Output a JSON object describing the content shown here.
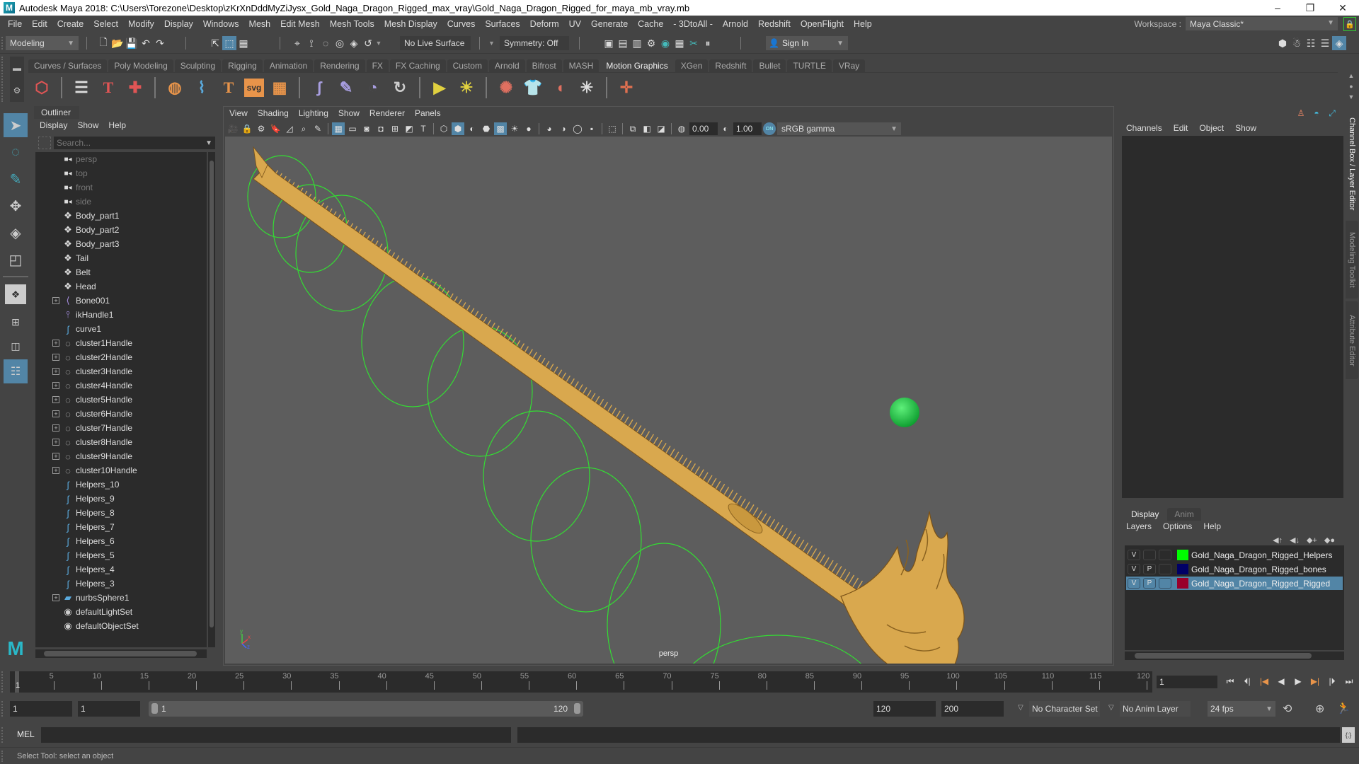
{
  "window": {
    "title": "Autodesk Maya 2018: C:\\Users\\Torezone\\Desktop\\zKrXnDddMyZiJysx_Gold_Naga_Dragon_Rigged_max_vray\\Gold_Naga_Dragon_Rigged_for_maya_mb_vray.mb",
    "minimize": "–",
    "restore": "❐",
    "close": "✕"
  },
  "menubar": {
    "items": [
      "File",
      "Edit",
      "Create",
      "Select",
      "Modify",
      "Display",
      "Windows",
      "Mesh",
      "Edit Mesh",
      "Mesh Tools",
      "Mesh Display",
      "Curves",
      "Surfaces",
      "Deform",
      "UV",
      "Generate",
      "Cache",
      "- 3DtoAll -",
      "Arnold",
      "Redshift",
      "OpenFlight",
      "Help"
    ],
    "workspace_label": "Workspace :",
    "workspace_value": "Maya Classic*"
  },
  "statusline": {
    "mode": "Modeling",
    "live_surface": "No Live Surface",
    "symmetry": "Symmetry: Off",
    "sign_in": "Sign In"
  },
  "shelf": {
    "tabs": [
      "Curves / Surfaces",
      "Poly Modeling",
      "Sculpting",
      "Rigging",
      "Animation",
      "Rendering",
      "FX",
      "FX Caching",
      "Custom",
      "Arnold",
      "Bifrost",
      "MASH",
      "Motion Graphics",
      "XGen",
      "Redshift",
      "Bullet",
      "TURTLE",
      "VRay"
    ],
    "active_tab": "Motion Graphics"
  },
  "outliner": {
    "title": "Outliner",
    "menu": [
      "Display",
      "Show",
      "Help"
    ],
    "search_placeholder": "Search...",
    "items": [
      {
        "name": "persp",
        "icon": "camera-icon",
        "expandable": false,
        "dim": true
      },
      {
        "name": "top",
        "icon": "camera-icon",
        "expandable": false,
        "dim": true
      },
      {
        "name": "front",
        "icon": "camera-icon",
        "expandable": false,
        "dim": true
      },
      {
        "name": "side",
        "icon": "camera-icon",
        "expandable": false,
        "dim": true
      },
      {
        "name": "Body_part1",
        "icon": "mesh-icon",
        "expandable": false
      },
      {
        "name": "Body_part2",
        "icon": "mesh-icon",
        "expandable": false
      },
      {
        "name": "Body_part3",
        "icon": "mesh-icon",
        "expandable": false
      },
      {
        "name": "Tail",
        "icon": "mesh-icon",
        "expandable": false
      },
      {
        "name": "Belt",
        "icon": "mesh-icon",
        "expandable": false
      },
      {
        "name": "Head",
        "icon": "mesh-icon",
        "expandable": false
      },
      {
        "name": "Bone001",
        "icon": "joint-icon",
        "expandable": true
      },
      {
        "name": "ikHandle1",
        "icon": "ik-handle-icon",
        "expandable": false
      },
      {
        "name": "curve1",
        "icon": "curve-icon",
        "expandable": false
      },
      {
        "name": "cluster1Handle",
        "icon": "cluster-icon",
        "expandable": true
      },
      {
        "name": "cluster2Handle",
        "icon": "cluster-icon",
        "expandable": true
      },
      {
        "name": "cluster3Handle",
        "icon": "cluster-icon",
        "expandable": true
      },
      {
        "name": "cluster4Handle",
        "icon": "cluster-icon",
        "expandable": true
      },
      {
        "name": "cluster5Handle",
        "icon": "cluster-icon",
        "expandable": true
      },
      {
        "name": "cluster6Handle",
        "icon": "cluster-icon",
        "expandable": true
      },
      {
        "name": "cluster7Handle",
        "icon": "cluster-icon",
        "expandable": true
      },
      {
        "name": "cluster8Handle",
        "icon": "cluster-icon",
        "expandable": true
      },
      {
        "name": "cluster9Handle",
        "icon": "cluster-icon",
        "expandable": true
      },
      {
        "name": "cluster10Handle",
        "icon": "cluster-icon",
        "expandable": true
      },
      {
        "name": "Helpers_10",
        "icon": "curve-icon",
        "expandable": false
      },
      {
        "name": "Helpers_9",
        "icon": "curve-icon",
        "expandable": false
      },
      {
        "name": "Helpers_8",
        "icon": "curve-icon",
        "expandable": false
      },
      {
        "name": "Helpers_7",
        "icon": "curve-icon",
        "expandable": false
      },
      {
        "name": "Helpers_6",
        "icon": "curve-icon",
        "expandable": false
      },
      {
        "name": "Helpers_5",
        "icon": "curve-icon",
        "expandable": false
      },
      {
        "name": "Helpers_4",
        "icon": "curve-icon",
        "expandable": false
      },
      {
        "name": "Helpers_3",
        "icon": "curve-icon",
        "expandable": false
      },
      {
        "name": "nurbsSphere1",
        "icon": "nurbs-icon",
        "expandable": true
      },
      {
        "name": "defaultLightSet",
        "icon": "set-icon",
        "expandable": false
      },
      {
        "name": "defaultObjectSet",
        "icon": "set-icon",
        "expandable": false
      }
    ]
  },
  "viewport": {
    "menu": [
      "View",
      "Shading",
      "Lighting",
      "Show",
      "Renderer",
      "Panels"
    ],
    "exposure": "0.00",
    "gamma": "1.00",
    "color_management": "sRGB gamma",
    "camera": "persp",
    "model_color": "#d9a84e",
    "helper_color": "#33dd33",
    "ball_color": "#19c844"
  },
  "channelbox": {
    "menu": [
      "Channels",
      "Edit",
      "Object",
      "Show"
    ]
  },
  "layereditor": {
    "tabs": [
      "Display",
      "Anim"
    ],
    "active_tab": "Display",
    "menu": [
      "Layers",
      "Options",
      "Help"
    ],
    "layers": [
      {
        "v": "V",
        "p": "",
        "name": "Gold_Naga_Dragon_Rigged_Helpers",
        "color": "#00ff00",
        "selected": false
      },
      {
        "v": "V",
        "p": "P",
        "name": "Gold_Naga_Dragon_Rigged_bones",
        "color": "#000066",
        "selected": false
      },
      {
        "v": "V",
        "p": "P",
        "name": "Gold_Naga_Dragon_Rigged_Rigged",
        "color": "#99002a",
        "selected": true
      }
    ]
  },
  "side_tabs": [
    "Channel Box / Layer Editor",
    "Modeling Toolkit",
    "Attribute Editor"
  ],
  "timeline": {
    "ticks": [
      5,
      10,
      15,
      20,
      25,
      30,
      35,
      40,
      45,
      50,
      55,
      60,
      65,
      70,
      75,
      80,
      85,
      90,
      95,
      100,
      105,
      110,
      115,
      120
    ],
    "min": 1,
    "max": 120,
    "current_frame": "1",
    "current_frame_field": "1"
  },
  "range": {
    "start": "1",
    "playback_start": "1",
    "bar_start": "1",
    "bar_end": "120",
    "playback_end": "120",
    "end": "200",
    "character_set": "No Character Set",
    "anim_layer": "No Anim Layer",
    "fps": "24 fps"
  },
  "command": {
    "label": "MEL"
  },
  "helpline": {
    "text": "Select Tool: select an object"
  }
}
